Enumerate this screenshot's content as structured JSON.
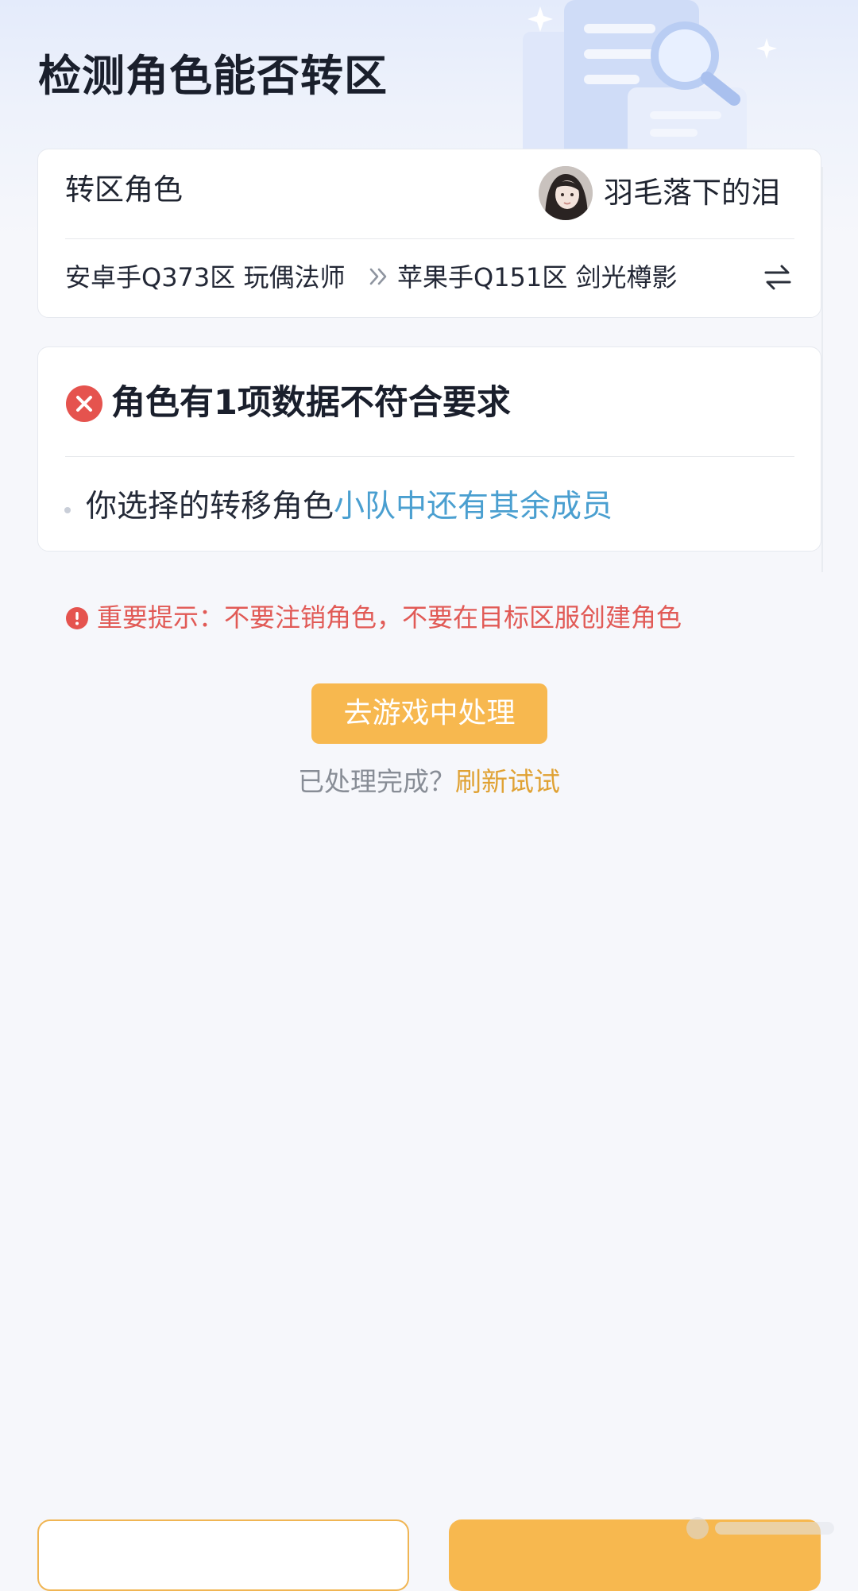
{
  "page": {
    "title": "检测角色能否转区"
  },
  "role_card": {
    "label": "转区角色",
    "character_name": "羽毛落下的泪",
    "source": "安卓手Q373区 玩偶法师",
    "target": "苹果手Q151区 剑光樽影",
    "arrow_icon": "double-chevron-right-icon",
    "swap_icon": "swap-arrows-icon",
    "avatar_icon": "avatar"
  },
  "check_card": {
    "status_icon": "error-circle-icon",
    "status_title": "角色有1项数据不符合要求",
    "items": [
      {
        "prefix": "你选择的转移角色",
        "highlight": "小队中还有其余成员"
      }
    ]
  },
  "notice": {
    "icon": "alert-circle-icon",
    "text": "重要提示：不要注销角色，不要在目标区服创建角色"
  },
  "actions": {
    "primary_label": "去游戏中处理",
    "refresh_question": "已处理完成？",
    "refresh_link": "刷新试试"
  },
  "colors": {
    "accent": "#f7b84f",
    "error": "#e15a56",
    "link": "#4a9fd0",
    "refresh_link": "#e0a234"
  }
}
